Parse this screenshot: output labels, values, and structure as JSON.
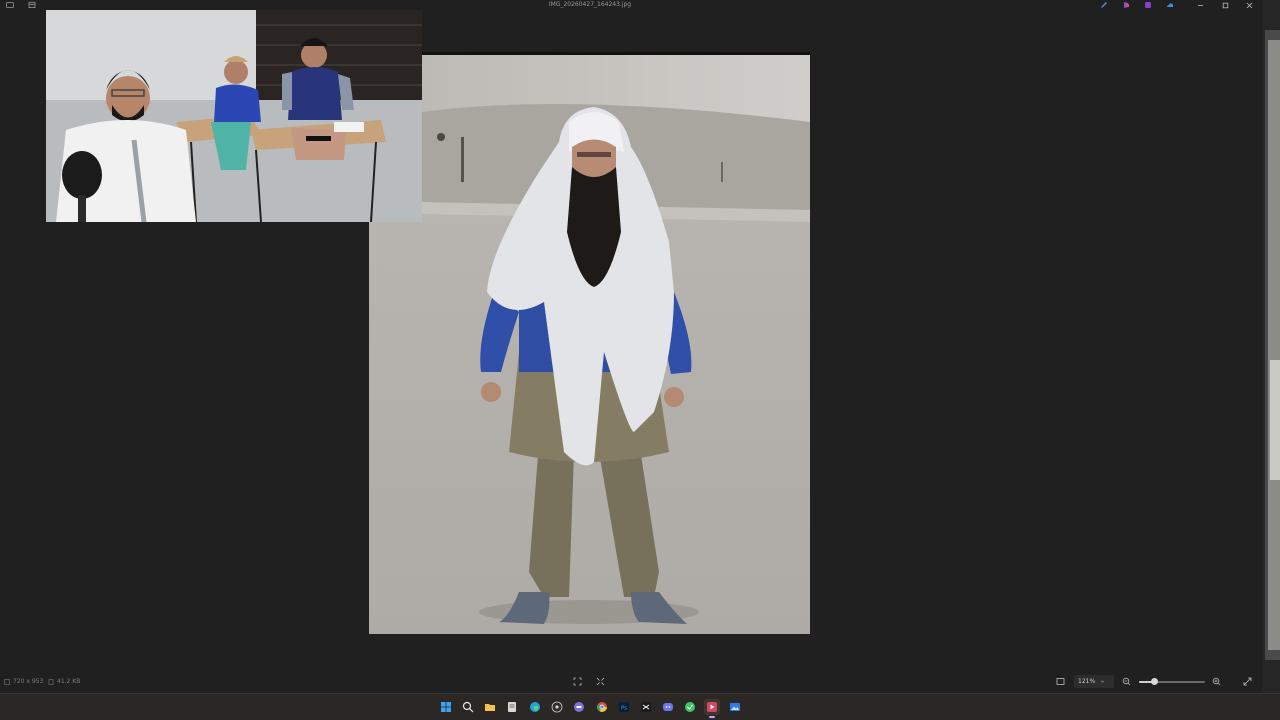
{
  "window": {
    "title": "IMG_20260427_164243.jpg",
    "controls": {
      "minimize": "minimize",
      "maximize": "maximize",
      "close": "close"
    },
    "title_icons": [
      "gallery-icon",
      "pin-icon"
    ],
    "app_icons": [
      "edit-icon",
      "copilot-icon",
      "clipchamp-icon",
      "onedrive-icon"
    ]
  },
  "photo": {
    "description_icon": "photo",
    "zoom_level": 121
  },
  "webcam": {
    "icon": "webcam-overlay"
  },
  "status": {
    "dimensions": "720 x 953",
    "file_size": "41.2 KB"
  },
  "zoom": {
    "value": "121%",
    "slider_fraction": 0.22
  },
  "colors": {
    "background": "#202020",
    "taskbar": "#2b2724",
    "accent": "#c9a3ff"
  },
  "taskbar": {
    "items": [
      {
        "name": "start",
        "icon": "windows-icon"
      },
      {
        "name": "search",
        "icon": "search-icon"
      },
      {
        "name": "file-explorer",
        "icon": "folder-icon"
      },
      {
        "name": "notepad",
        "icon": "notepad-icon"
      },
      {
        "name": "edge",
        "icon": "edge-icon"
      },
      {
        "name": "obs",
        "icon": "obs-icon"
      },
      {
        "name": "app-purple",
        "icon": "app-icon"
      },
      {
        "name": "chrome",
        "icon": "chrome-icon"
      },
      {
        "name": "photoshop",
        "icon": "photoshop-icon",
        "label": "Ps"
      },
      {
        "name": "capcut",
        "icon": "capcut-icon"
      },
      {
        "name": "discord",
        "icon": "discord-icon"
      },
      {
        "name": "app-green",
        "icon": "app-icon"
      },
      {
        "name": "media-player",
        "icon": "media-player-icon"
      },
      {
        "name": "photos",
        "icon": "photos-icon"
      }
    ]
  }
}
